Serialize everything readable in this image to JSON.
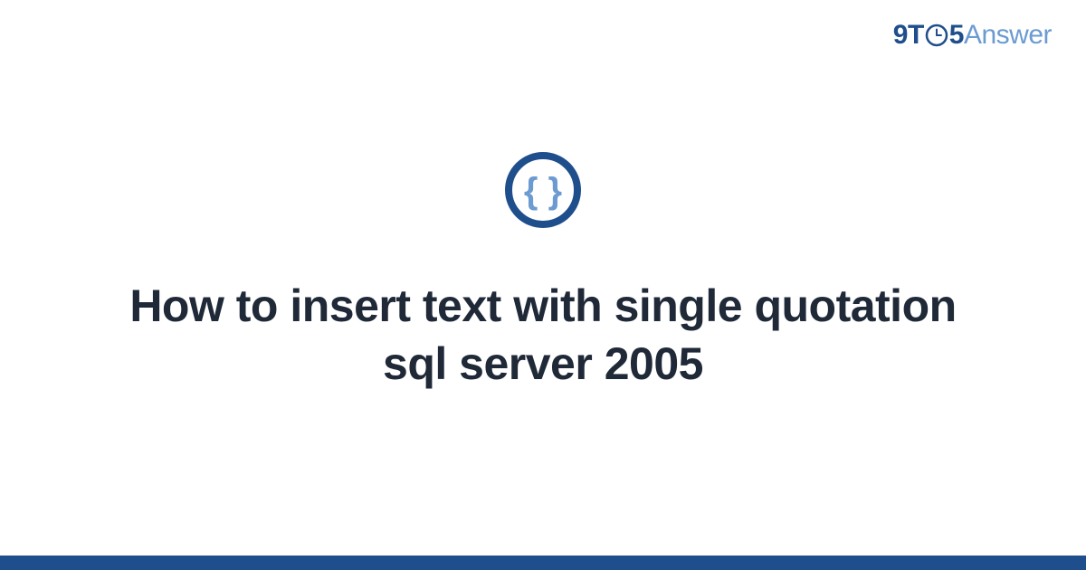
{
  "brand": {
    "part1": "9",
    "part2": "T",
    "part3": "5",
    "part4": "Answer"
  },
  "main": {
    "title": "How to insert text with single quotation sql server 2005"
  },
  "colors": {
    "dark_blue": "#1f4e8c",
    "light_blue": "#6b9bd1",
    "text": "#1f2937"
  }
}
